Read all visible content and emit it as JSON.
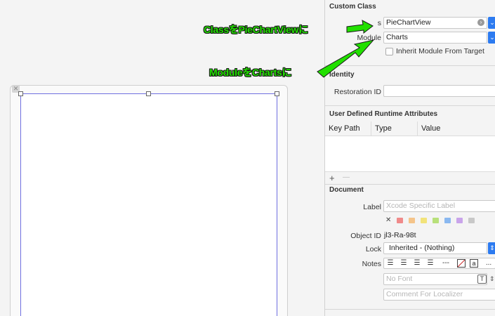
{
  "callouts": {
    "class_note": "ClassをPieChartViewに",
    "module_note": "ModuleをChartsに"
  },
  "custom_class": {
    "title": "Custom Class",
    "class_label_visible": "s",
    "class_value": "PieChartView",
    "module_label": "Module",
    "module_value": "Charts",
    "inherit_label": "Inherit Module From Target"
  },
  "identity": {
    "title": "Identity",
    "restoration_label": "Restoration ID",
    "restoration_value": ""
  },
  "runtime_attrs": {
    "title": "User Defined Runtime Attributes",
    "columns": [
      "Key Path",
      "Type",
      "Value"
    ],
    "add_symbol": "+",
    "remove_symbol": "—"
  },
  "document": {
    "title": "Document",
    "label_label": "Label",
    "label_placeholder": "Xcode Specific Label",
    "clear_symbol": "✕",
    "swatch_colors": [
      "#f08a8a",
      "#f5c48a",
      "#f2e37a",
      "#b8e07a",
      "#8ab8f0",
      "#c9a4ea",
      "#c8c8c8"
    ],
    "object_id_label": "Object ID",
    "object_id_value": "jl3-Ra-98t",
    "lock_label": "Lock",
    "lock_value": "Inherited - (Nothing)",
    "notes_label": "Notes",
    "dash_label": "---",
    "more_label": "...",
    "font_placeholder": "No Font",
    "comment_placeholder": "Comment For Localizer"
  },
  "colors": {
    "callout_green": "#22e000",
    "accent_blue": "#2d7bf0",
    "view_border": "#6f6fe0"
  }
}
